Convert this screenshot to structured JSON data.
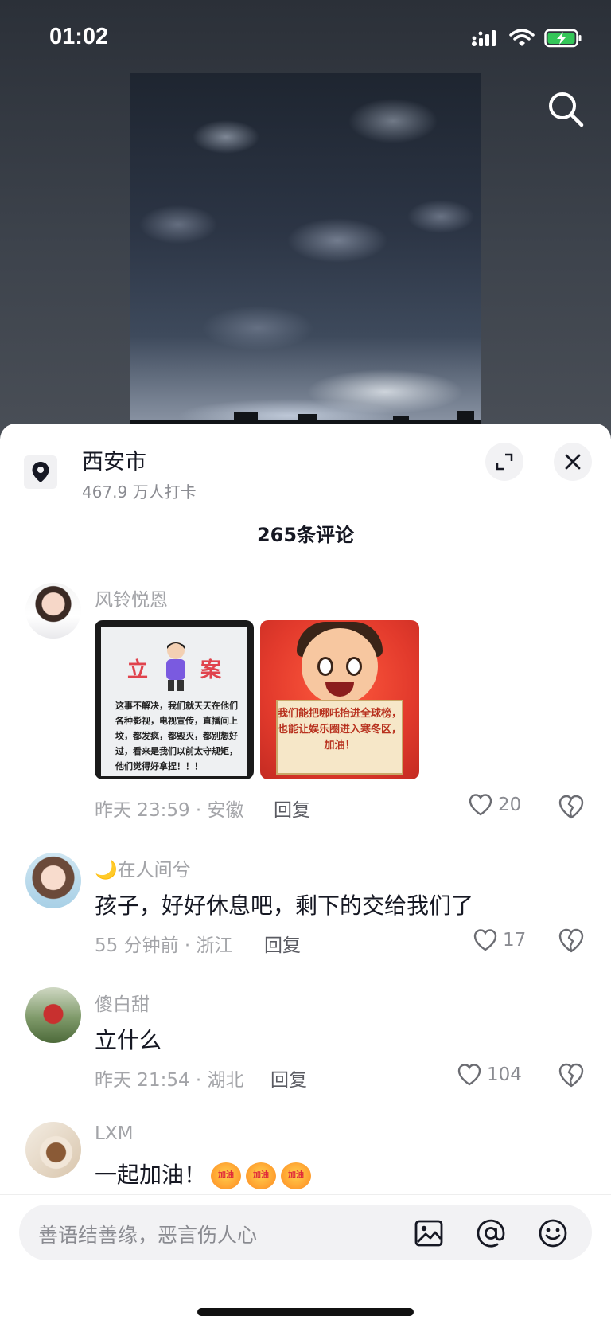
{
  "status_bar": {
    "time": "01:02"
  },
  "location": {
    "name": "西安市",
    "checkins": "467.9 万人打卡"
  },
  "comment_count": "265条评论",
  "comments": [
    {
      "user": "风铃悦恩",
      "images": [
        {
          "title_left": "立",
          "title_right": "案",
          "text": "这事不解决，我们就天天在他们各种影视，电视宣传，直播间上坟，都发疯，都毁灭，都别想好过，看来是我们以前太守规矩，他们觉得好拿捏！！！"
        },
        {
          "text": "我们能把哪吒抬进全球榜，也能让娱乐圈进入寒冬区，加油！"
        }
      ],
      "meta": "昨天 23:59 · 安徽",
      "reply": "回复",
      "likes": "20"
    },
    {
      "user": "🌙在人间兮",
      "text": "孩子，好好休息吧，剩下的交给我们了",
      "meta": "55 分钟前 · 浙江",
      "reply": "回复",
      "likes": "17"
    },
    {
      "user": "傻白甜",
      "text": "立什么",
      "meta": "昨天 21:54 · 湖北",
      "reply": "回复",
      "likes": "104"
    },
    {
      "user": "LXM",
      "text": "一起加油！",
      "emoji_label": "加油"
    }
  ],
  "input": {
    "placeholder": "善语结善缘，恶言伤人心"
  },
  "colors": {
    "accent_text": "#161823",
    "muted_text": "#a3a4a8",
    "sheet_bg": "#ffffff"
  }
}
